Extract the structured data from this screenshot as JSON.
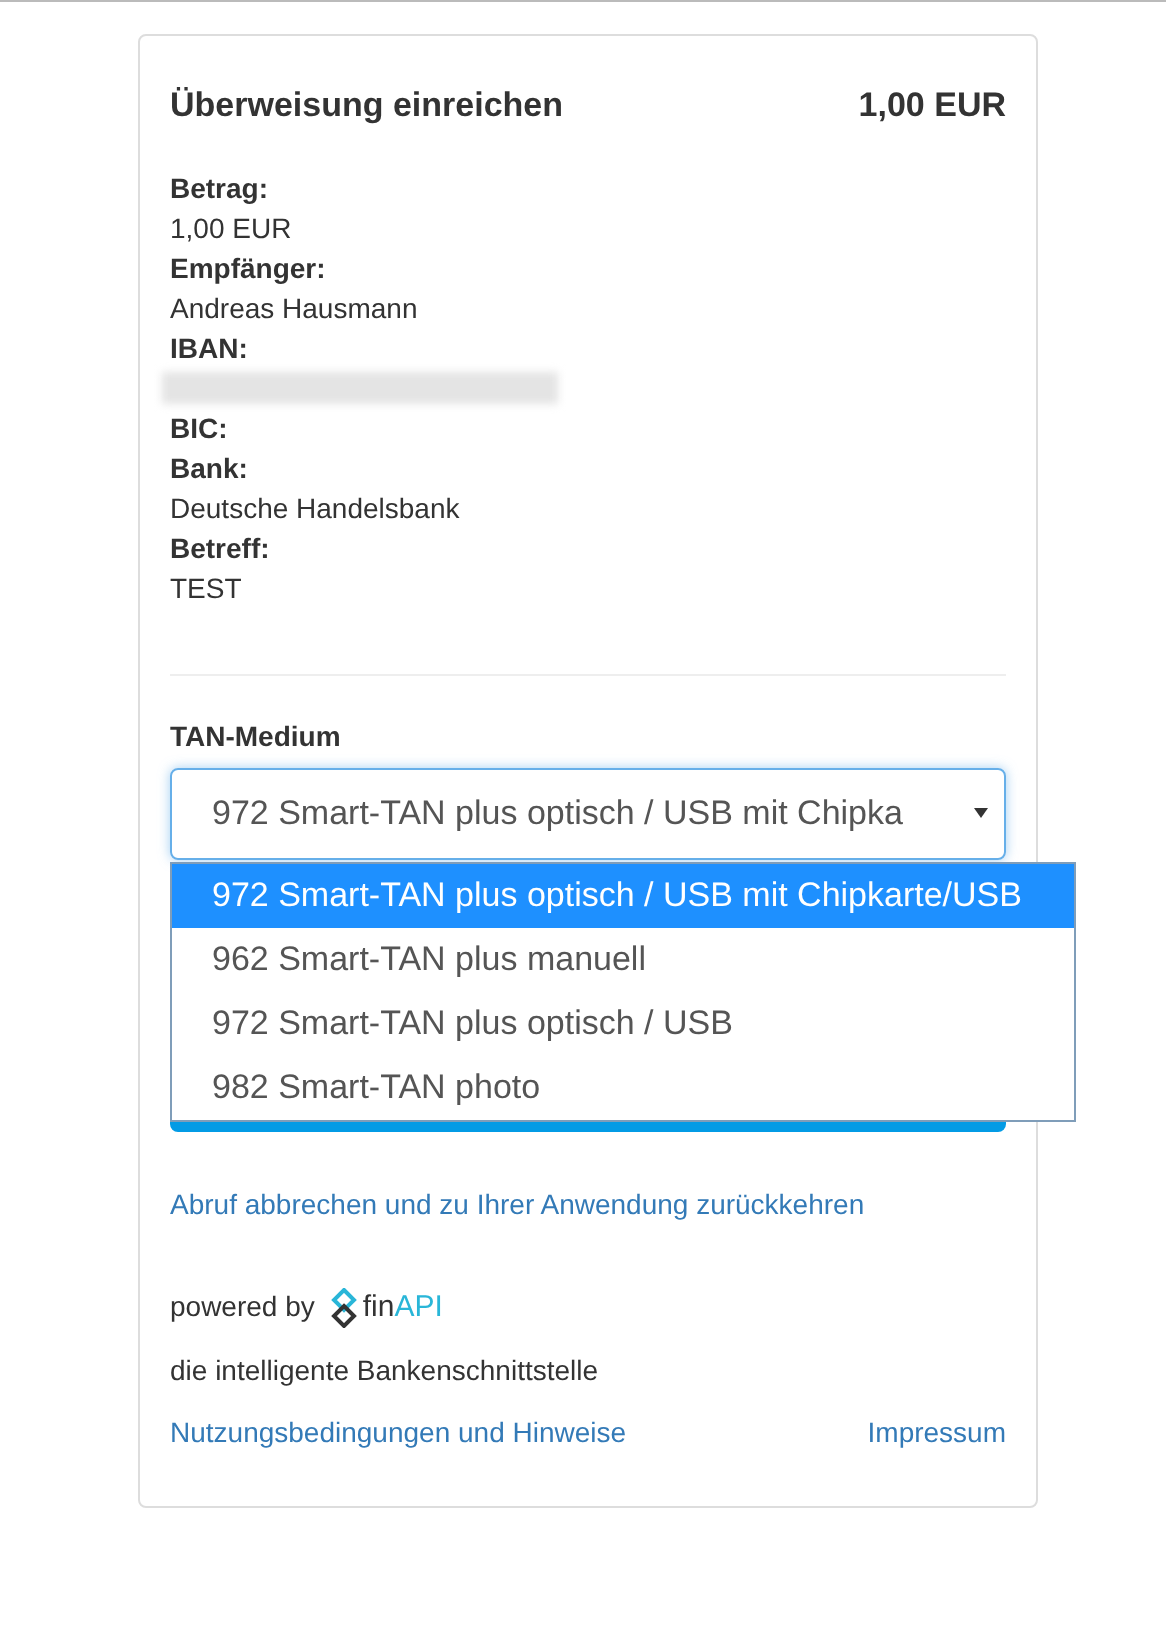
{
  "header": {
    "title": "Überweisung einreichen",
    "amount": "1,00 EUR"
  },
  "details": [
    {
      "kind": "text",
      "label": "Betrag:",
      "value": "1,00 EUR"
    },
    {
      "kind": "text",
      "label": "Empfänger:",
      "value": "Andreas Hausmann"
    },
    {
      "kind": "blurred",
      "label": "IBAN:"
    },
    {
      "kind": "text",
      "label": "BIC:"
    },
    {
      "kind": "text",
      "label": "Bank:",
      "value": "Deutsche Handelsbank"
    },
    {
      "kind": "text",
      "label": "Betreff:",
      "value": "TEST"
    }
  ],
  "tan_medium": {
    "label": "TAN-Medium",
    "value": "972 Smart-TAN plus optisch / USB mit Chipka",
    "expanded": true,
    "options": [
      {
        "label": "972 Smart-TAN plus optisch / USB mit Chipkarte/USB",
        "selected": true
      },
      {
        "label": "962 Smart-TAN plus manuell",
        "selected": false
      },
      {
        "label": "972 Smart-TAN plus optisch / USB",
        "selected": false
      },
      {
        "label": "982 Smart-TAN photo",
        "selected": false
      }
    ]
  },
  "cancel_link": "Abruf abbrechen und zu Ihrer Anwendung zurückkehren",
  "powered_by": {
    "text": "powered by",
    "logo_text": [
      "fin",
      "API"
    ]
  },
  "tagline": "die intelligente Bankenschnittstelle",
  "footer_links": [
    "Nutzungsbedingungen und Hinweise",
    "Impressum"
  ]
}
